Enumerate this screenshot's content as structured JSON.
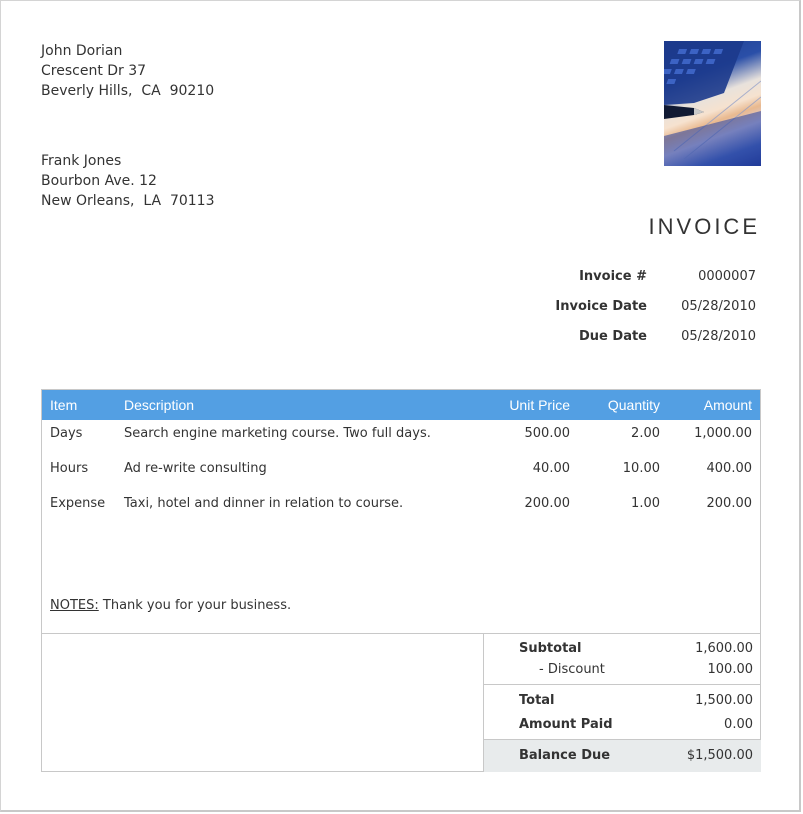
{
  "sender": {
    "name": "John Dorian",
    "street": "Crescent Dr 37",
    "city_line": "Beverly Hills,  CA  90210"
  },
  "recipient": {
    "name": "Frank Jones",
    "street": "Bourbon Ave. 12",
    "city_line": "New Orleans,  LA  70113"
  },
  "logo": {
    "icon": "calculator-pen-photo"
  },
  "invoice": {
    "title": "INVOICE",
    "meta": [
      {
        "label": "Invoice #",
        "value": "0000007"
      },
      {
        "label": "Invoice Date",
        "value": "05/28/2010"
      },
      {
        "label": "Due Date",
        "value": "05/28/2010"
      }
    ]
  },
  "table": {
    "header_color": "#539fe3",
    "columns": {
      "item": "Item",
      "description": "Description",
      "unit_price": "Unit Price",
      "quantity": "Quantity",
      "amount": "Amount"
    },
    "rows": [
      {
        "item": "Days",
        "description": "Search engine marketing course. Two full days.",
        "unit_price": "500.00",
        "quantity": "2.00",
        "amount": "1,000.00"
      },
      {
        "item": "Hours",
        "description": "Ad re-write consulting",
        "unit_price": "40.00",
        "quantity": "10.00",
        "amount": "400.00"
      },
      {
        "item": "Expense",
        "description": "Taxi, hotel and dinner in relation to course.",
        "unit_price": "200.00",
        "quantity": "1.00",
        "amount": "200.00"
      }
    ]
  },
  "notes": {
    "label": "NOTES:",
    "text": " Thank you for your business."
  },
  "totals": {
    "subtotal_label": "Subtotal",
    "subtotal": "1,600.00",
    "discount_label": "- Discount",
    "discount": "100.00",
    "total_label": "Total",
    "total": "1,500.00",
    "paid_label": "Amount Paid",
    "paid": "0.00",
    "balance_label": "Balance Due",
    "balance": "$1,500.00"
  }
}
